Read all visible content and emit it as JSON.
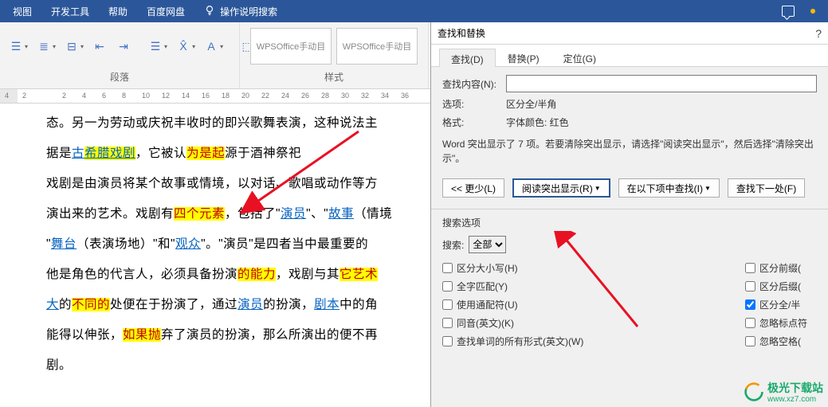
{
  "menubar": {
    "items": [
      "视图",
      "开发工具",
      "帮助",
      "百度网盘"
    ],
    "search_placeholder": "操作说明搜索"
  },
  "ribbon": {
    "paragraph_label": "段落",
    "styles_label": "样式",
    "style1": "WPSOffice手动目",
    "style2": "WPSOffice手动目"
  },
  "ruler": [
    "4",
    "2",
    "",
    "2",
    "4",
    "6",
    "8",
    "10",
    "12",
    "14",
    "16",
    "18",
    "20",
    "22",
    "24",
    "26",
    "28",
    "30",
    "32",
    "34",
    "36"
  ],
  "document": {
    "l1a": "态。另一为劳动或庆祝丰收时的即兴歌舞表演，这种说法主",
    "l2a": "据是",
    "l2b": "古",
    "l2c": "希腊戏剧",
    "l2d": "，它被认",
    "l2e": "为是起",
    "l2f": "源于酒神祭祀",
    "l3": "戏剧是由演员将某个故事或情境，以对话、歌唱或动作等方",
    "l4a": "演出来的艺术。戏剧有",
    "l4b": "四个元素",
    "l4c": "，包括了\"",
    "l4d": "演员",
    "l4e": "\"、\"",
    "l4f": "故事",
    "l4g": "（情境",
    "l5a": "\"",
    "l5b": "舞台",
    "l5c": "（表演场地）\"和\"",
    "l5d": "观众",
    "l5e": "\"。\"演员\"是四者当中最重要的",
    "l6a": "他是角色的代言人，必须具备扮演",
    "l6b": "的能力",
    "l6c": "，戏剧与其",
    "l6d": "它艺术",
    "l7a": "大",
    "l7b": "的",
    "l7c": "不同的",
    "l7d": "处便在于扮演了，通过",
    "l7e": "演员",
    "l7f": "的扮演，",
    "l7g": "剧本",
    "l7h": "中的角",
    "l8a": "能得以伸张，",
    "l8b": "如果抛",
    "l8c": "弃了演员的扮演，那么所演出的便不再",
    "l9": "剧。"
  },
  "dialog": {
    "title": "查找和替换",
    "tabs": {
      "find": "查找(D)",
      "replace": "替换(P)",
      "goto": "定位(G)"
    },
    "find_label": "查找内容(N):",
    "options_label": "选项:",
    "options_value": "区分全/半角",
    "format_label": "格式:",
    "format_value": "字体颜色: 红色",
    "result_msg": "Word 突出显示了 7 项。若要清除突出显示，请选择\"阅读突出显示\"，然后选择\"清除突出示\"。",
    "btn_less": "<< 更少(L)",
    "btn_highlight": "阅读突出显示(R)",
    "btn_findin": "在以下项中查找(I)",
    "btn_findnext": "查找下一处(F)",
    "search_options": "搜索选项",
    "search_label": "搜索:",
    "search_value": "全部",
    "chk_case": "区分大小写(H)",
    "chk_whole": "全字匹配(Y)",
    "chk_wildcard": "使用通配符(U)",
    "chk_sounds": "同音(英文)(K)",
    "chk_forms": "查找单词的所有形式(英文)(W)",
    "chk_prefix": "区分前缀(",
    "chk_suffix": "区分后缀(",
    "chk_width": "区分全/半",
    "chk_punct": "忽略标点符",
    "chk_space": "忽略空格("
  },
  "watermark": {
    "name": "极光下载站",
    "url": "www.xz7.com"
  }
}
